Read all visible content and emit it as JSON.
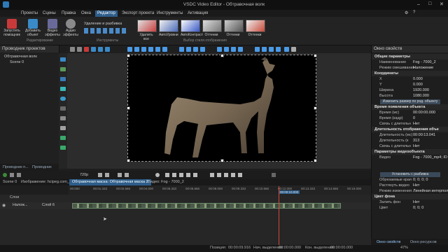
{
  "app": {
    "title": "VSDC Video Editor - Обтравочная волк"
  },
  "menu": [
    "Проекты",
    "Сцены",
    "Правка",
    "Окна",
    "Редактор",
    "Экспорт проекта",
    "Инструменты",
    "Активация"
  ],
  "ribbon": {
    "buttons": [
      "Запустить помощник",
      "Добавить объект",
      "Видео эффекты",
      "Аудио эффекты"
    ],
    "group_editing": "Редактирование",
    "cut_split": "Удаление и разбивка",
    "group_tools": "Инструменты",
    "thumbs": [
      "Удалить все",
      "АвтоУровни",
      "АвтоКонтраст",
      "Оттенки",
      "Оттенки",
      "Оттенки"
    ],
    "group_styles": "Выбор стиля отображения"
  },
  "left_panel": {
    "title": "Проводник проектов",
    "tree": [
      "Обтравочная волк",
      "Scene 0"
    ],
    "tabs": [
      "Проводник п...",
      "Проводник о..."
    ]
  },
  "playbar": {
    "resolution": "720р"
  },
  "timeline": {
    "tabs": [
      "Scene 0",
      "Изображение: hcipeg.com_2",
      "Обтравочная маска: Обтравочная маска 2",
      "Видео: Fog - 7000_2"
    ],
    "active_tab_index": 2,
    "ruler": [
      "00:000",
      "00:01.333",
      "00:02.666",
      "00:04.000",
      "00:05.333",
      "00:06.666",
      "00:08.000",
      "00:09.333",
      "00:10.666",
      "00:12.000",
      "00:13.333",
      "00:14.666",
      "00:16.000"
    ],
    "layers_header": "Слои",
    "track_blend": "Налож...",
    "track_label": "Слой 6",
    "playhead_time": "00:00:10.000"
  },
  "properties": {
    "title": "Окно свойств",
    "sections": [
      {
        "header": "Общие параметры",
        "rows": [
          {
            "k": "Наименование",
            "v": "Fog - 7000_2"
          },
          {
            "k": "Режим смешивания",
            "v": "Наложение"
          }
        ]
      },
      {
        "header": "Координаты",
        "rows": [
          {
            "k": "X",
            "v": "0.000"
          },
          {
            "k": "Y",
            "v": "0.000"
          },
          {
            "k": "Ширина",
            "v": "1920.000"
          },
          {
            "k": "Высота",
            "v": "1080.000"
          }
        ],
        "button": "Изменить размер по род. объекту"
      },
      {
        "header": "Время появления объекта",
        "rows": [
          {
            "k": "Время (мс)",
            "v": "00:00:00.000"
          },
          {
            "k": "Время (кадр)",
            "v": "0"
          },
          {
            "k": "Связь с длительн",
            "v": "Нет"
          }
        ]
      },
      {
        "header": "Длительность отображения объе",
        "rows": [
          {
            "k": "Длительность (мс)",
            "v": "00:00:13.041"
          },
          {
            "k": "Длительность (к",
            "v": "313"
          },
          {
            "k": "Связь с длительн",
            "v": "Нет"
          }
        ]
      },
      {
        "header": "Параметры видеообъекта",
        "rows": [
          {
            "k": "Видео",
            "v": "Fog - 7000_mp4; ID"
          },
          {
            "k": "",
            "v": ""
          },
          {
            "k": "",
            "v": ""
          }
        ],
        "button": "Установить с разбивка"
      },
      {
        "header": "",
        "rows": [
          {
            "k": "Обрезаемые края",
            "v": "0; 0; 0; 0"
          },
          {
            "k": "Растянуть видео",
            "v": "Нет"
          },
          {
            "k": "Режим изменения",
            "v": "Линейная интерпол"
          }
        ]
      },
      {
        "header": "Цвет фона",
        "rows": [
          {
            "k": "Залить фон",
            "v": "Нет"
          },
          {
            "k": "Цвет",
            "v": "0; 0; 0"
          }
        ]
      }
    ],
    "tabs": [
      "Окно свойств",
      "Окно ресурсов"
    ]
  },
  "status": {
    "position_label": "Позиция:",
    "position": "00:00:09.916",
    "start_sel_label": "Нач. выделения:",
    "start_sel": "00:00:00.000",
    "end_sel_label": "Кон. выделения:",
    "end_sel": "00:00:00.000",
    "zoom": "47%"
  },
  "colors": {
    "accent": "#2d5d8a",
    "playhead": "#d24a3a"
  }
}
